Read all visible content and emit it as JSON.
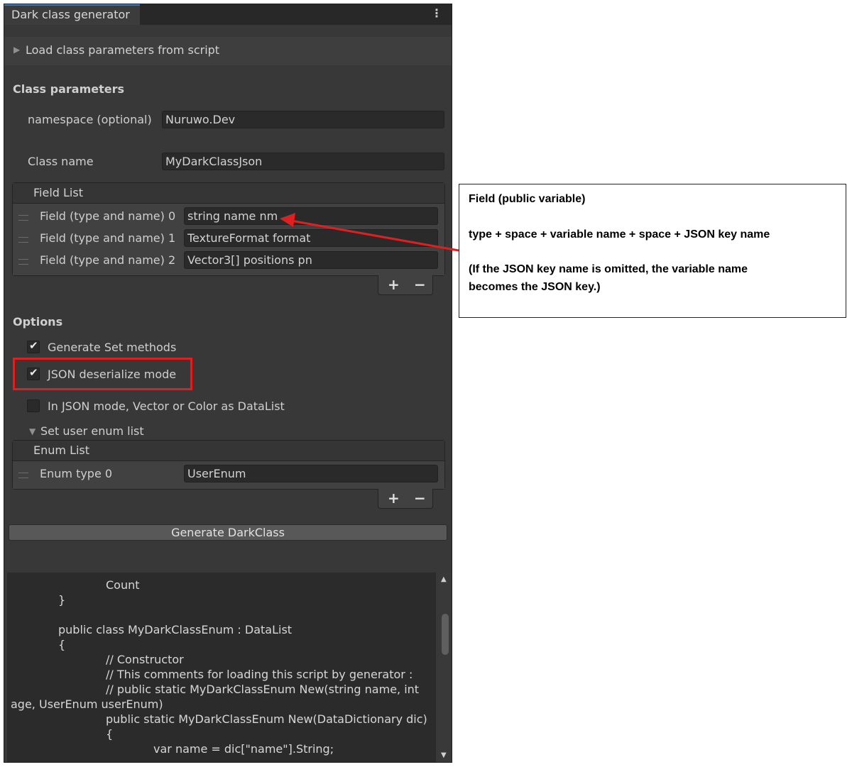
{
  "window": {
    "tab_title": "Dark class generator",
    "menu_icon": "kebab-menu-icon"
  },
  "load_foldout": {
    "label": "Load class parameters from script"
  },
  "class_parameters": {
    "title": "Class parameters",
    "namespace_label": "namespace (optional)",
    "namespace_value": "Nuruwo.Dev",
    "class_name_label": "Class name",
    "class_name_value": "MyDarkClassJson"
  },
  "field_list": {
    "header": "Field List",
    "items": [
      {
        "label": "Field (type and name) 0",
        "value": "string name nm"
      },
      {
        "label": "Field (type and name) 1",
        "value": "TextureFormat format"
      },
      {
        "label": "Field (type and name) 2",
        "value": "Vector3[] positions pn"
      }
    ],
    "add": "+",
    "remove": "−"
  },
  "options": {
    "title": "Options",
    "generate_set_methods": {
      "label": "Generate Set methods",
      "checked": true
    },
    "json_deserialize": {
      "label": "JSON deserialize mode",
      "checked": true
    },
    "vector_color_datalist": {
      "label": "In JSON mode, Vector or Color as DataList",
      "checked": false
    },
    "user_enum_foldout": "Set user enum list"
  },
  "enum_list": {
    "header": "Enum List",
    "items": [
      {
        "label": "Enum type 0",
        "value": "UserEnum"
      }
    ],
    "add": "+",
    "remove": "−"
  },
  "generate_button": "Generate DarkClass",
  "code_lines": [
    "Count",
    "}",
    "public class MyDarkClassEnum : DataList",
    "{",
    "// Constructor",
    "// This comments for loading this script by generator :",
    "// public static MyDarkClassEnum New(string name, int",
    "age, UserEnum userEnum)",
    "public static MyDarkClassEnum New(DataDictionary dic)",
    "{",
    "var name = dic[\"name\"].String;"
  ],
  "callout": {
    "line1": "Field (public variable)",
    "line2": "type + space + variable name + space +  JSON key name",
    "line3": "(If the JSON key name is omitted, the variable name",
    "line4": "becomes the JSON key.)"
  },
  "colors": {
    "panel_bg": "#383838",
    "field_bg": "#2a2a2a",
    "accent": "#3a79bb",
    "annotation_red": "#e02020"
  }
}
